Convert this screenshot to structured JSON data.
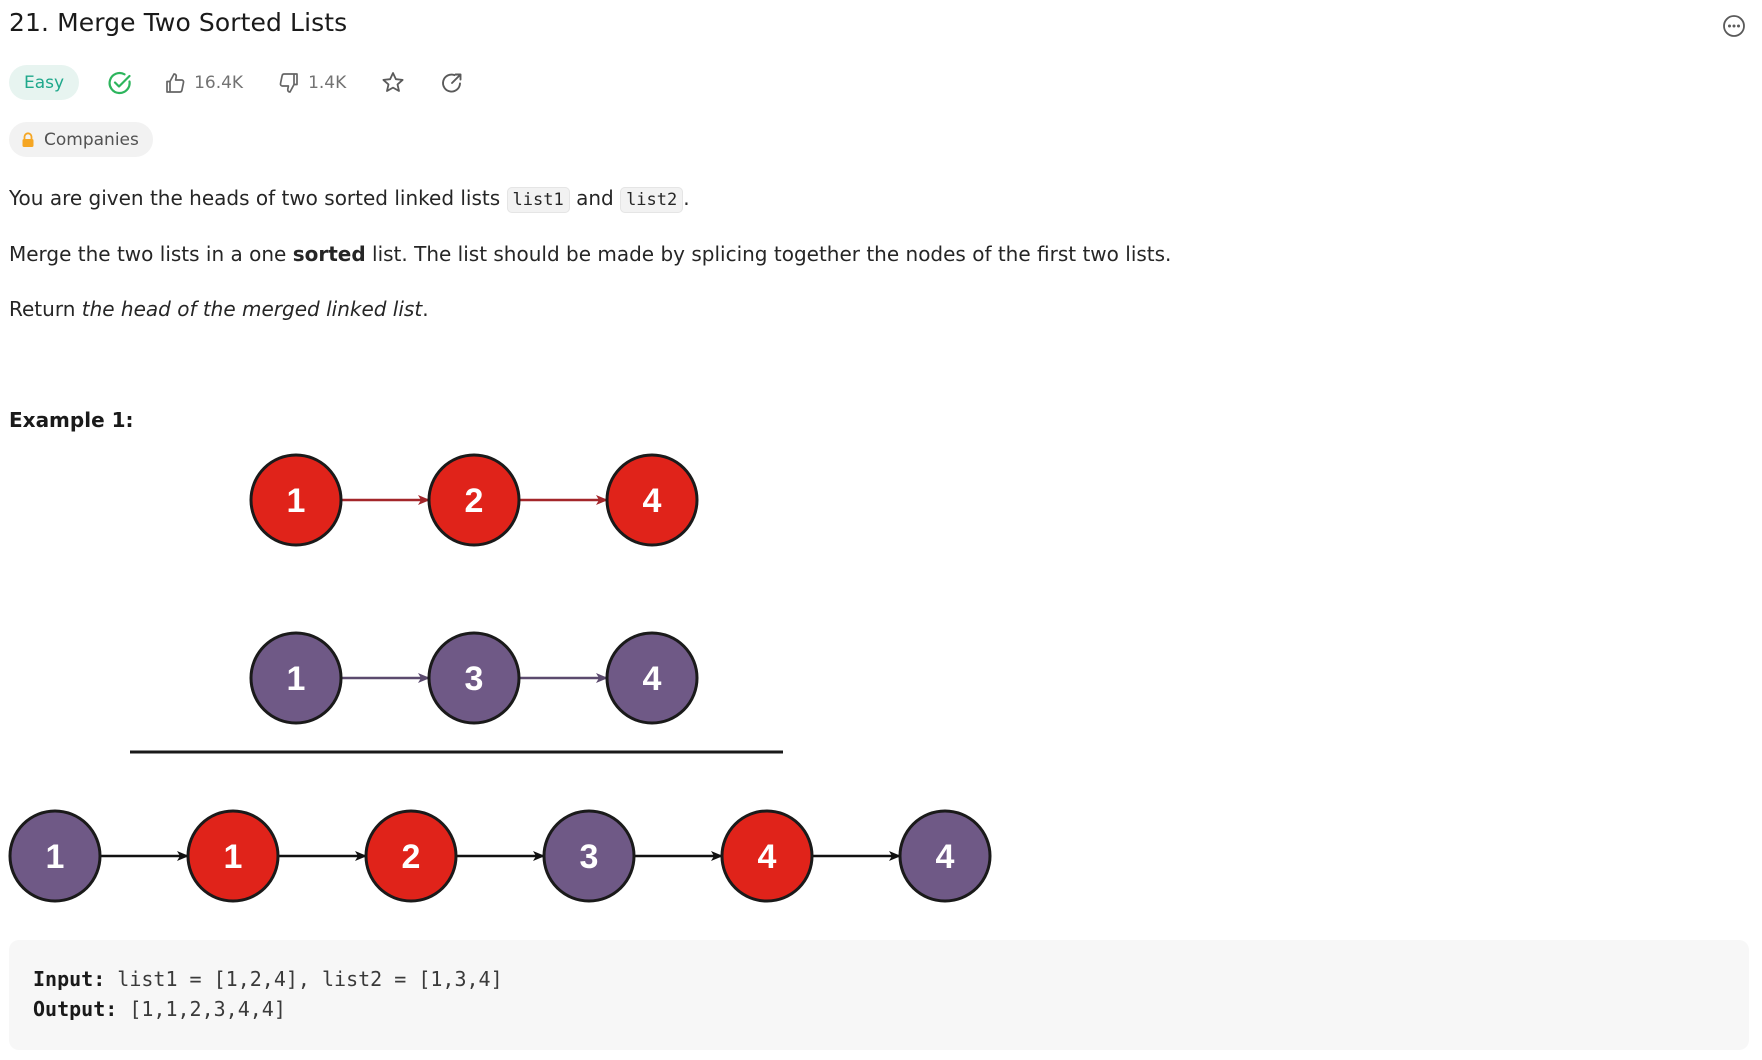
{
  "problem": {
    "title": "21. Merge Two Sorted Lists",
    "difficulty": "Easy",
    "likes": "16.4K",
    "dislikes": "1.4K",
    "companies_label": "Companies"
  },
  "description": {
    "p1_before": "You are given the heads of two sorted linked lists ",
    "p1_code1": "list1",
    "p1_mid": " and ",
    "p1_code2": "list2",
    "p1_after": ".",
    "p2_before": "Merge the two lists in a one ",
    "p2_bold": "sorted",
    "p2_after": " list. The list should be made by splicing together the nodes of the first two lists.",
    "p3_before": "Return ",
    "p3_italic": "the head of the merged linked list",
    "p3_after": "."
  },
  "example": {
    "title": "Example 1:",
    "input_label": "Input:",
    "input_value": " list1 = [1,2,4], list2 = [1,3,4]",
    "output_label": "Output:",
    "output_value": " [1,1,2,3,4,4]",
    "diagram": {
      "list1": [
        "1",
        "2",
        "4"
      ],
      "list2": [
        "1",
        "3",
        "4"
      ],
      "merged": [
        {
          "label": "1",
          "source": "list2"
        },
        {
          "label": "1",
          "source": "list1"
        },
        {
          "label": "2",
          "source": "list1"
        },
        {
          "label": "3",
          "source": "list2"
        },
        {
          "label": "4",
          "source": "list1"
        },
        {
          "label": "4",
          "source": "list2"
        }
      ]
    }
  },
  "colors": {
    "list1_node": "#e0231a",
    "list2_node": "#6f5986",
    "easy_text": "#1fa88b",
    "easy_bg": "#e7f4f0",
    "solved_check": "#2db55d"
  },
  "icons": {
    "more": "more-horizontal-circle-icon",
    "solved": "check-circle-icon",
    "like": "thumbs-up-icon",
    "dislike": "thumbs-down-icon",
    "favorite": "star-icon",
    "share": "share-icon",
    "lock": "lock-icon"
  }
}
